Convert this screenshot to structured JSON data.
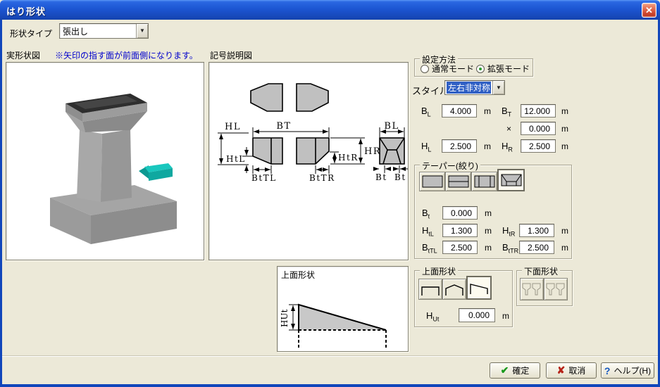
{
  "window": {
    "title": "はり形状",
    "close_icon": "✕"
  },
  "icons": {
    "dropdown": "▼"
  },
  "shape_type": {
    "label": "形状タイプ",
    "value": "張出し"
  },
  "real_view": {
    "label": "実形状図",
    "note": "※矢印の指す面が前面側になります。"
  },
  "symbol_view": {
    "label": "記号説明図",
    "dims": {
      "hl": "HL",
      "bt": "BT",
      "bl": "BL",
      "htl": "HtL",
      "bttl": "BtTL",
      "htr": "HtR",
      "bttr": "BtTR",
      "hr": "HR",
      "bt1": "Bt",
      "bt2": "Bt"
    }
  },
  "plan_view": {
    "label": "上面形状",
    "dim": "HUt"
  },
  "setting_method": {
    "label": "設定方法",
    "normal": "通常モード",
    "extended": "拡張モード"
  },
  "style": {
    "label": "スタイル",
    "value": "左右非対称"
  },
  "dims": {
    "bl": {
      "base": "B",
      "sub": "L",
      "value": "4.000",
      "unit": "m"
    },
    "bt": {
      "base": "B",
      "sub": "T",
      "value": "12.000",
      "unit": "m"
    },
    "x": {
      "label": "×",
      "value": "0.000",
      "unit": "m"
    },
    "hl": {
      "base": "H",
      "sub": "L",
      "value": "2.500",
      "unit": "m"
    },
    "hr": {
      "base": "H",
      "sub": "R",
      "value": "2.500",
      "unit": "m"
    }
  },
  "taper": {
    "label": "テーパー(絞り)",
    "bt": {
      "base": "B",
      "sub": "t",
      "value": "0.000",
      "unit": "m"
    },
    "htl": {
      "base": "H",
      "sub": "tL",
      "value": "1.300",
      "unit": "m"
    },
    "htr": {
      "base": "H",
      "sub": "tR",
      "value": "1.300",
      "unit": "m"
    },
    "bttl": {
      "base": "B",
      "sub": "tTL",
      "value": "2.500",
      "unit": "m"
    },
    "bttr": {
      "base": "B",
      "sub": "tTR",
      "value": "2.500",
      "unit": "m"
    }
  },
  "top_shape": {
    "label": "上面形状",
    "hut": {
      "base": "H",
      "sub": "Ut",
      "value": "0.000",
      "unit": "m"
    }
  },
  "bottom_shape": {
    "label": "下面形状"
  },
  "actions": {
    "confirm": {
      "label": "確定",
      "icon": "✔"
    },
    "cancel": {
      "label": "取消",
      "icon": "✘"
    },
    "help": {
      "label": "ヘルプ(H)",
      "icon": "?"
    }
  },
  "colors": {
    "titlebar_blue": "#1c55d2",
    "selection_blue": "#2f5fc4",
    "note_blue": "#0000cc",
    "confirm_green": "#18991c",
    "cancel_red": "#b62318",
    "help_blue": "#1557c0",
    "shape_gray": "#c0c0c0",
    "arrow_teal": "#17b9b1"
  }
}
